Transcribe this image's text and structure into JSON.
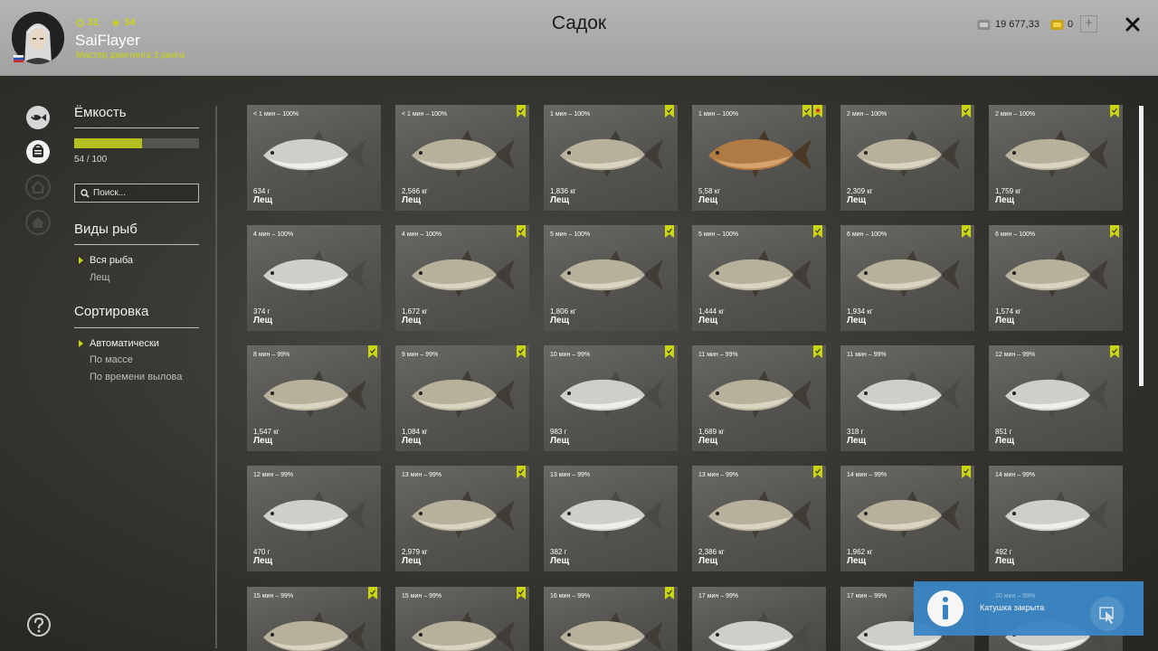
{
  "header": {
    "title": "Садок",
    "username": "SaiFlayer",
    "rank": "Мастер джиггинга 3 ранга",
    "level": "31",
    "stars": "34",
    "money": "19 677,33",
    "gold": "0",
    "plus": "+"
  },
  "sidebar": {
    "capacity_title": "Ёмкость",
    "capacity_text": "54 / 100",
    "capacity_fraction": 0.54,
    "search_placeholder": "Поиск...",
    "species_title": "Виды рыб",
    "species_options": [
      "Вся рыба",
      "Лещ"
    ],
    "sort_title": "Сортировка",
    "sort_options": [
      "Автоматически",
      "По массе",
      "По времени вылова"
    ]
  },
  "colors": {
    "accent": "#c9d60e",
    "bar": "#b3c020",
    "notification": "#3a86c5"
  },
  "cards": [
    {
      "time": "< 1 мин – 100%",
      "weight": "634 г",
      "species": "Лещ",
      "badges": [],
      "fish": "silver"
    },
    {
      "time": "< 1 мин – 100%",
      "weight": "2,566 кг",
      "species": "Лещ",
      "badges": [
        "green"
      ],
      "fish": "bronze"
    },
    {
      "time": "1 мин – 100%",
      "weight": "1,836 кг",
      "species": "Лещ",
      "badges": [
        "green"
      ],
      "fish": "bronze"
    },
    {
      "time": "1 мин – 100%",
      "weight": "5,58 кг",
      "species": "Лещ",
      "badges": [
        "green",
        "star"
      ],
      "fish": "gold"
    },
    {
      "time": "2 мин – 100%",
      "weight": "2,309 кг",
      "species": "Лещ",
      "badges": [
        "green"
      ],
      "fish": "bronze"
    },
    {
      "time": "2 мин – 100%",
      "weight": "1,759 кг",
      "species": "Лещ",
      "badges": [
        "green"
      ],
      "fish": "bronze"
    },
    {
      "time": "4 мин – 100%",
      "weight": "374 г",
      "species": "Лещ",
      "badges": [],
      "fish": "silver"
    },
    {
      "time": "4 мин – 100%",
      "weight": "1,672 кг",
      "species": "Лещ",
      "badges": [
        "green"
      ],
      "fish": "bronze"
    },
    {
      "time": "5 мин – 100%",
      "weight": "1,806 кг",
      "species": "Лещ",
      "badges": [
        "green"
      ],
      "fish": "bronze"
    },
    {
      "time": "5 мин – 100%",
      "weight": "1,444 кг",
      "species": "Лещ",
      "badges": [
        "green"
      ],
      "fish": "bronze"
    },
    {
      "time": "6 мин – 100%",
      "weight": "1,934 кг",
      "species": "Лещ",
      "badges": [
        "green"
      ],
      "fish": "bronze"
    },
    {
      "time": "6 мин – 100%",
      "weight": "1,574 кг",
      "species": "Лещ",
      "badges": [
        "green"
      ],
      "fish": "bronze"
    },
    {
      "time": "8 мин – 99%",
      "weight": "1,547 кг",
      "species": "Лещ",
      "badges": [
        "green"
      ],
      "fish": "bronze"
    },
    {
      "time": "9 мин – 99%",
      "weight": "1,084 кг",
      "species": "Лещ",
      "badges": [
        "green"
      ],
      "fish": "bronze"
    },
    {
      "time": "10 мин – 99%",
      "weight": "983 г",
      "species": "Лещ",
      "badges": [
        "green"
      ],
      "fish": "silver"
    },
    {
      "time": "11 мин – 99%",
      "weight": "1,689 кг",
      "species": "Лещ",
      "badges": [
        "green"
      ],
      "fish": "bronze"
    },
    {
      "time": "11 мин – 99%",
      "weight": "318 г",
      "species": "Лещ",
      "badges": [],
      "fish": "silver"
    },
    {
      "time": "12 мин – 99%",
      "weight": "851 г",
      "species": "Лещ",
      "badges": [
        "green"
      ],
      "fish": "silver"
    },
    {
      "time": "12 мин – 99%",
      "weight": "470 г",
      "species": "Лещ",
      "badges": [],
      "fish": "silver"
    },
    {
      "time": "13 мин – 99%",
      "weight": "2,979 кг",
      "species": "Лещ",
      "badges": [
        "green"
      ],
      "fish": "bronze"
    },
    {
      "time": "13 мин – 99%",
      "weight": "382 г",
      "species": "Лещ",
      "badges": [],
      "fish": "silver"
    },
    {
      "time": "13 мин – 99%",
      "weight": "2,386 кг",
      "species": "Лещ",
      "badges": [
        "green"
      ],
      "fish": "bronze"
    },
    {
      "time": "14 мин – 99%",
      "weight": "1,962 кг",
      "species": "Лещ",
      "badges": [
        "green"
      ],
      "fish": "bronze"
    },
    {
      "time": "14 мин – 99%",
      "weight": "492 г",
      "species": "Лещ",
      "badges": [],
      "fish": "silver"
    },
    {
      "time": "15 мин – 99%",
      "weight": "",
      "species": "",
      "badges": [
        "green"
      ],
      "fish": "bronze"
    },
    {
      "time": "15 мин – 99%",
      "weight": "",
      "species": "",
      "badges": [
        "green"
      ],
      "fish": "bronze"
    },
    {
      "time": "16 мин – 99%",
      "weight": "",
      "species": "",
      "badges": [
        "green"
      ],
      "fish": "bronze"
    },
    {
      "time": "17 мин – 99%",
      "weight": "",
      "species": "",
      "badges": [],
      "fish": "silver"
    },
    {
      "time": "17 мин – 99%",
      "weight": "",
      "species": "",
      "badges": [],
      "fish": "silver"
    },
    {
      "time": "",
      "weight": "",
      "species": "",
      "badges": [],
      "fish": "silver"
    }
  ],
  "notification": {
    "subtitle": "20 мин – 99%",
    "text": "Катушка закрыта"
  }
}
